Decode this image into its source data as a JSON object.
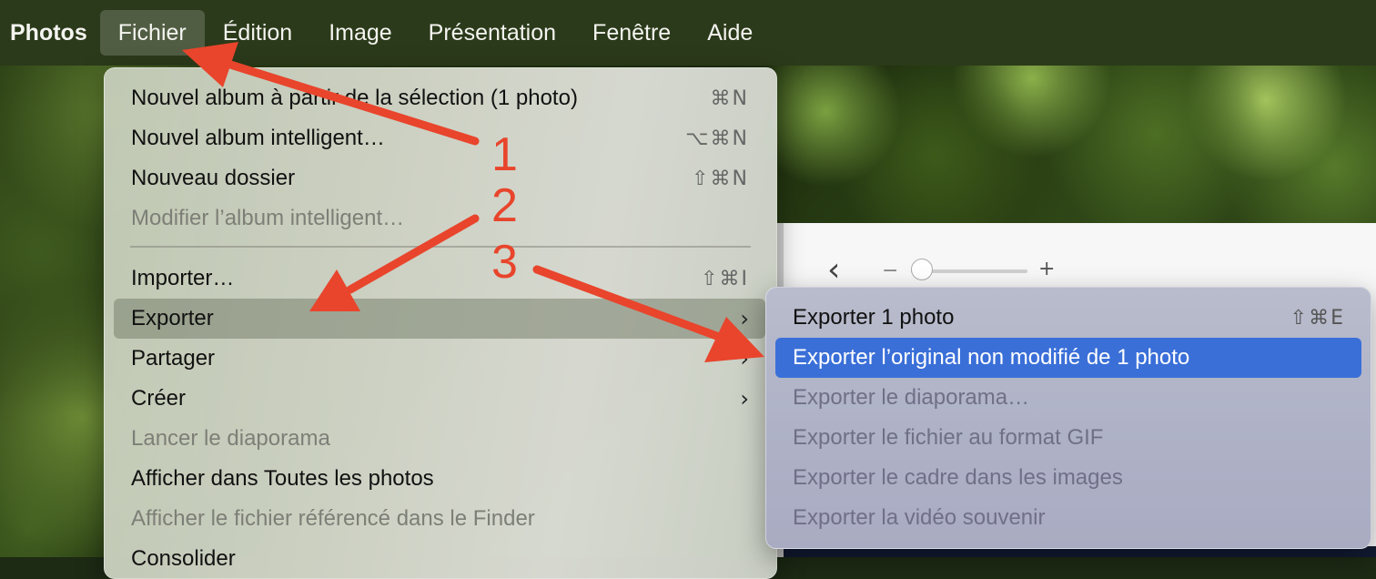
{
  "menubar": {
    "app": "Photos",
    "items": [
      "Fichier",
      "Édition",
      "Image",
      "Présentation",
      "Fenêtre",
      "Aide"
    ]
  },
  "file_menu": {
    "items": [
      {
        "label": "Nouvel album à partir de la sélection (1 photo)",
        "shortcut": "⌘N"
      },
      {
        "label": "Nouvel album intelligent…",
        "shortcut": "⌥⌘N"
      },
      {
        "label": "Nouveau dossier",
        "shortcut": "⇧⌘N"
      },
      {
        "label": "Modifier l’album intelligent…",
        "shortcut": ""
      },
      {
        "label": "Importer…",
        "shortcut": "⇧⌘I"
      },
      {
        "label": "Exporter",
        "chevron": "›"
      },
      {
        "label": "Partager",
        "chevron": "›"
      },
      {
        "label": "Créer",
        "chevron": "›"
      },
      {
        "label": "Lancer le diaporama",
        "shortcut": ""
      },
      {
        "label": "Afficher dans Toutes les photos",
        "shortcut": ""
      },
      {
        "label": "Afficher le fichier référencé dans le Finder",
        "shortcut": ""
      },
      {
        "label": "Consolider",
        "shortcut": ""
      }
    ]
  },
  "export_menu": {
    "items": [
      {
        "label": "Exporter 1 photo",
        "shortcut": "⇧⌘E"
      },
      {
        "label": "Exporter l’original non modifié de 1 photo",
        "shortcut": ""
      },
      {
        "label": "Exporter le diaporama…",
        "shortcut": ""
      },
      {
        "label": "Exporter le fichier au format GIF",
        "shortcut": ""
      },
      {
        "label": "Exporter le cadre dans les images",
        "shortcut": ""
      },
      {
        "label": "Exporter la vidéo souvenir",
        "shortcut": ""
      }
    ]
  },
  "toolbar": {
    "back": "‹",
    "zoom_minus": "−",
    "zoom_plus": "+"
  },
  "annotations": [
    "1",
    "2",
    "3"
  ],
  "colors": {
    "annotation": "#e8452c",
    "selection": "#3a6fd8",
    "menubar": "#2b3a1a"
  }
}
